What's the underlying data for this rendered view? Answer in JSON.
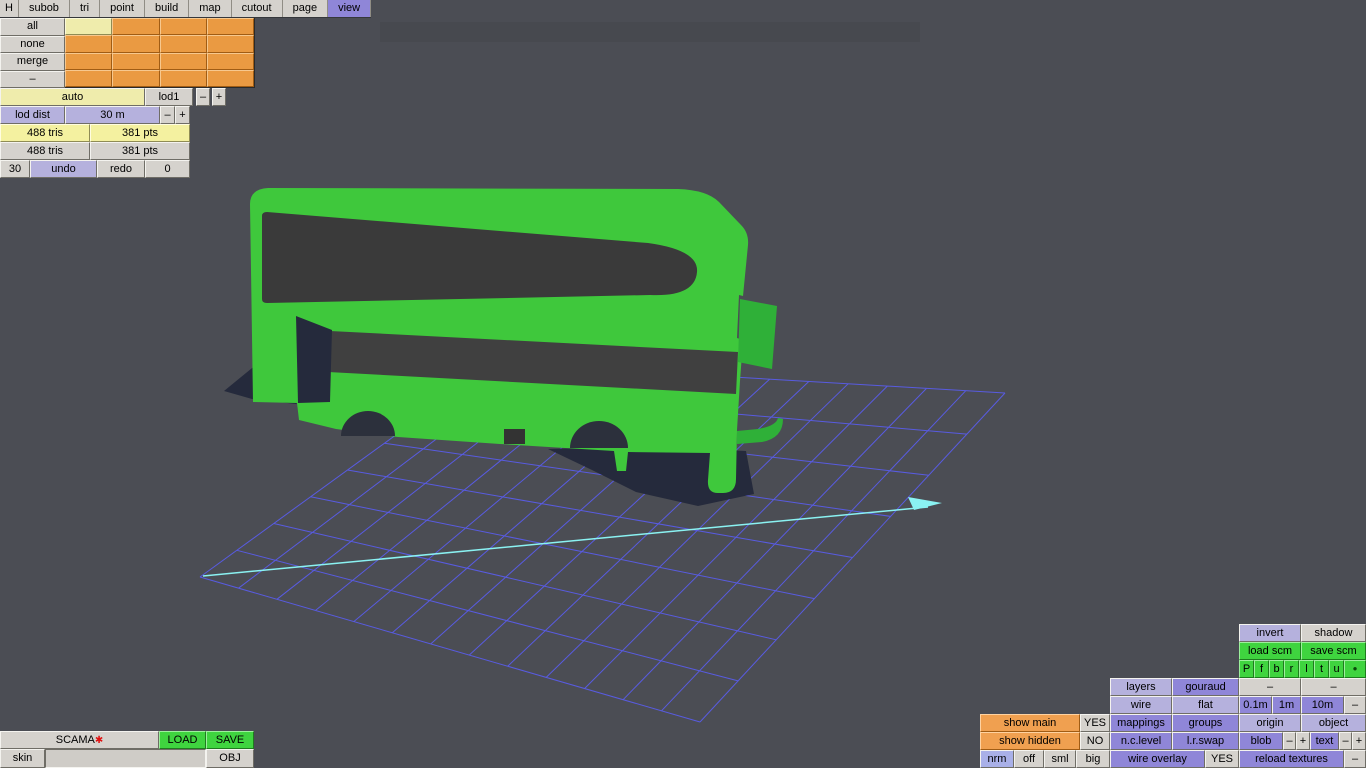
{
  "menu": {
    "items": [
      "H",
      "subob",
      "tri",
      "point",
      "build",
      "map",
      "cutout",
      "page",
      "view"
    ]
  },
  "selection": {
    "all": "all",
    "none": "none",
    "merge": "merge",
    "dash": "–"
  },
  "lod": {
    "auto": "auto",
    "lod1": "lod1",
    "minus": "–",
    "plus": "+",
    "dist_label": "lod dist",
    "dist_value": "30 m",
    "dist_minus": "–",
    "dist_plus": "+"
  },
  "stats": {
    "tris_current": "488 tris",
    "pts_current": "381 pts",
    "tris_total": "488 tris",
    "pts_total": "381 pts"
  },
  "history": {
    "count": "30",
    "undo": "undo",
    "redo": "redo",
    "redo_count": "0"
  },
  "file": {
    "name": "SCAMA",
    "star": "✱",
    "load": "LOAD",
    "save": "SAVE",
    "skin": "skin",
    "skin_value": "",
    "obj": "OBJ"
  },
  "right": {
    "invert": "invert",
    "shadow": "shadow",
    "load_scm": "load scm",
    "save_scm": "save scm",
    "letters": [
      "P",
      "f",
      "b",
      "r",
      "l",
      "t",
      "u"
    ],
    "dot": "●",
    "layers": "layers",
    "gouraud": "gouraud",
    "dash1": "–",
    "dash2": "–",
    "wire": "wire",
    "flat": "flat",
    "m01": "0.1m",
    "m1": "1m",
    "m10": "10m",
    "dash3": "–",
    "show_main": "show main",
    "show_main_val": "YES",
    "mappings": "mappings",
    "groups": "groups",
    "origin": "origin",
    "object": "object",
    "show_hidden": "show hidden",
    "show_hidden_val": "NO",
    "nclevel": "n.c.level",
    "lrswap": "l.r.swap",
    "blob": "blob",
    "blob_minus": "–",
    "blob_plus": "+",
    "text": "text",
    "text_minus": "–",
    "text_plus": "+",
    "nrm": "nrm",
    "off": "off",
    "sml": "sml",
    "big": "big",
    "wire_overlay": "wire overlay",
    "wire_overlay_val": "YES",
    "reload_textures": "reload textures",
    "dash4": "–"
  },
  "colors": {
    "accent_purple": "#8f86d8",
    "lavender": "#b5b1dd",
    "green": "#3fd43f",
    "orange": "#ea9a42",
    "grid_blue": "#5a5df0",
    "bus_green": "#3fc83c",
    "axis_cyan": "#8af2f2",
    "viewport_bg": "#4b4d54"
  }
}
